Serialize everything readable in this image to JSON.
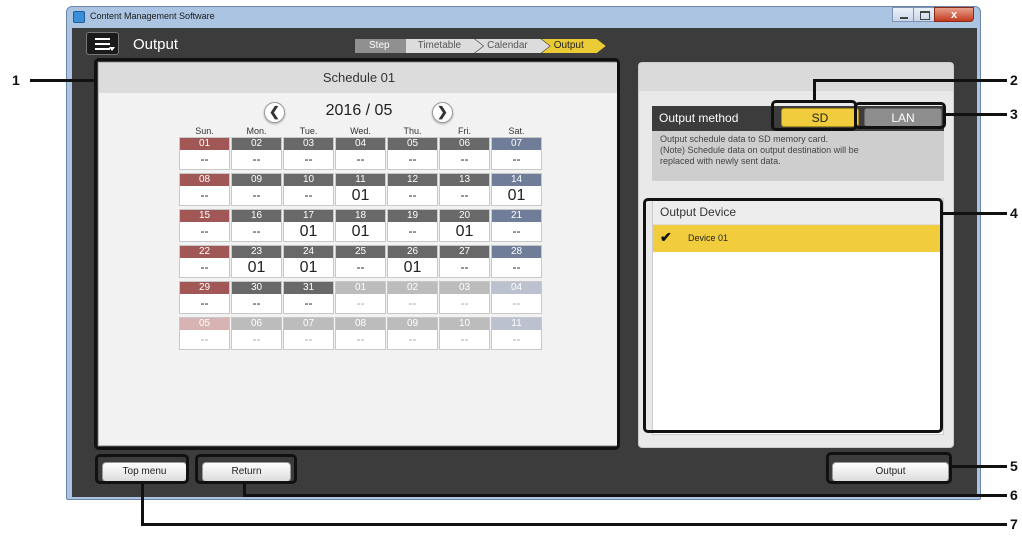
{
  "window": {
    "title": "Content Management Software",
    "close_glyph": "x"
  },
  "header": {
    "title": "Output"
  },
  "steps": {
    "label": "Step",
    "items": [
      "Timetable",
      "Calendar",
      "Output"
    ],
    "active": "Output"
  },
  "schedule": {
    "title": "Schedule 01",
    "month": "2016 / 05",
    "prev_glyph": "❮",
    "next_glyph": "❯",
    "weekdays": [
      "Sun.",
      "Mon.",
      "Tue.",
      "Wed.",
      "Thu.",
      "Fri.",
      "Sat."
    ],
    "weeks": [
      [
        {
          "d": "01",
          "v": "--"
        },
        {
          "d": "02",
          "v": "--"
        },
        {
          "d": "03",
          "v": "--"
        },
        {
          "d": "04",
          "v": "--"
        },
        {
          "d": "05",
          "v": "--"
        },
        {
          "d": "06",
          "v": "--"
        },
        {
          "d": "07",
          "v": "--"
        }
      ],
      [
        {
          "d": "08",
          "v": "--"
        },
        {
          "d": "09",
          "v": "--"
        },
        {
          "d": "10",
          "v": "--"
        },
        {
          "d": "11",
          "v": "01"
        },
        {
          "d": "12",
          "v": "--"
        },
        {
          "d": "13",
          "v": "--"
        },
        {
          "d": "14",
          "v": "01"
        }
      ],
      [
        {
          "d": "15",
          "v": "--"
        },
        {
          "d": "16",
          "v": "--"
        },
        {
          "d": "17",
          "v": "01"
        },
        {
          "d": "18",
          "v": "01"
        },
        {
          "d": "19",
          "v": "--"
        },
        {
          "d": "20",
          "v": "01"
        },
        {
          "d": "21",
          "v": "--"
        }
      ],
      [
        {
          "d": "22",
          "v": "--"
        },
        {
          "d": "23",
          "v": "01"
        },
        {
          "d": "24",
          "v": "01"
        },
        {
          "d": "25",
          "v": "--"
        },
        {
          "d": "26",
          "v": "01"
        },
        {
          "d": "27",
          "v": "--"
        },
        {
          "d": "28",
          "v": "--"
        }
      ],
      [
        {
          "d": "29",
          "v": "--"
        },
        {
          "d": "30",
          "v": "--"
        },
        {
          "d": "31",
          "v": "--"
        },
        {
          "d": "01",
          "v": "--",
          "out": true
        },
        {
          "d": "02",
          "v": "--",
          "out": true
        },
        {
          "d": "03",
          "v": "--",
          "out": true
        },
        {
          "d": "04",
          "v": "--",
          "out": true
        }
      ],
      [
        {
          "d": "05",
          "v": "--",
          "out": true
        },
        {
          "d": "06",
          "v": "--",
          "out": true
        },
        {
          "d": "07",
          "v": "--",
          "out": true
        },
        {
          "d": "08",
          "v": "--",
          "out": true
        },
        {
          "d": "09",
          "v": "--",
          "out": true
        },
        {
          "d": "10",
          "v": "--",
          "out": true
        },
        {
          "d": "11",
          "v": "--",
          "out": true
        }
      ]
    ]
  },
  "output_method": {
    "label": "Output method",
    "options": [
      "SD",
      "LAN"
    ],
    "selected": "SD",
    "description": [
      "Output schedule data to SD memory card.",
      "(Note) Schedule data on output destination will be",
      "replaced with newly sent data."
    ]
  },
  "output_device": {
    "title": "Output Device",
    "devices": [
      {
        "name": "Device 01",
        "checked": true,
        "check_glyph": "✔"
      }
    ]
  },
  "footer": {
    "top_menu": "Top menu",
    "return": "Return",
    "output": "Output"
  },
  "callouts": [
    "1",
    "2",
    "3",
    "4",
    "5",
    "6",
    "7"
  ],
  "colors": {
    "accent_yellow": "#f1cd3d",
    "sunday": "#a15756",
    "saturday": "#6f7d99",
    "weekday": "#696969",
    "background": "#3c3c3c"
  }
}
